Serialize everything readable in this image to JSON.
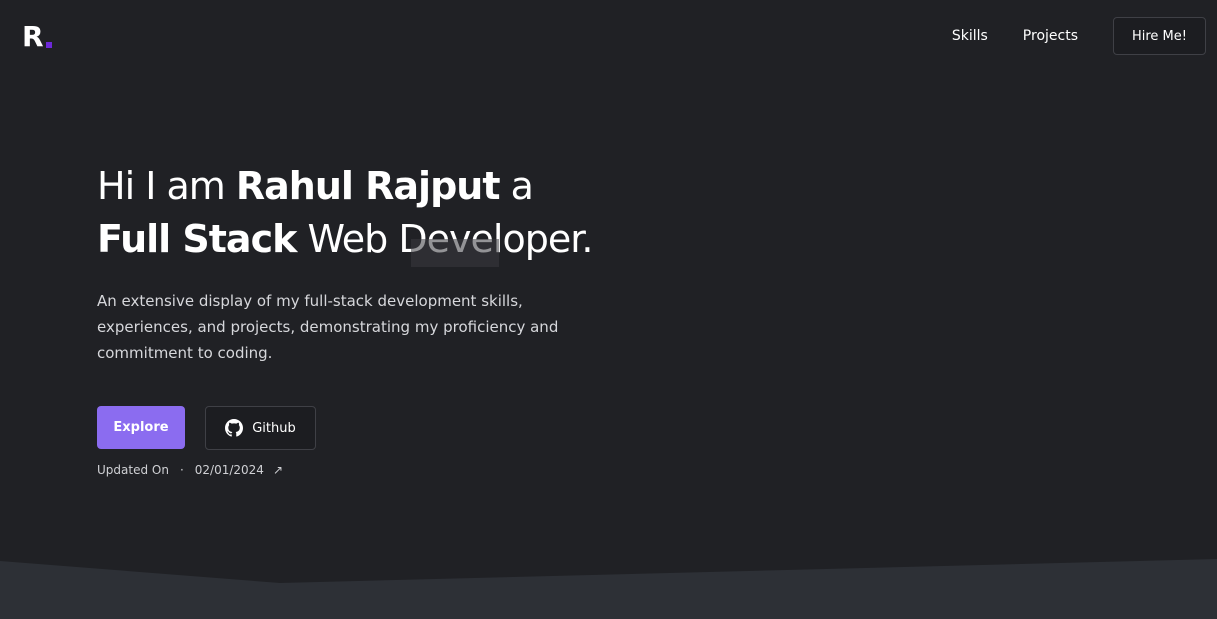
{
  "header": {
    "logo_letter": "R",
    "nav": {
      "skills": "Skills",
      "projects": "Projects"
    },
    "hire_label": "Hire Me!"
  },
  "hero": {
    "title": {
      "p1": "Hi I am ",
      "name": "Rahul Rajput",
      "p2": " a ",
      "role1": "Full Stack",
      "p3": " Web Developer."
    },
    "description": "An extensive display of my full-stack development skills, experiences, and projects, demonstrating my proficiency and commitment to coding.",
    "explore_label": "Explore",
    "github_label": "Github",
    "updated_label": "Updated On",
    "separator": "·",
    "updated_date": "02/01/2024"
  },
  "colors": {
    "background": "#202125",
    "accent": "#8b6cf0",
    "logo_dot": "#6d28d9",
    "wave": "#2d3036"
  },
  "icons": {
    "github": "github-icon",
    "external": "arrow-up-right-icon"
  }
}
